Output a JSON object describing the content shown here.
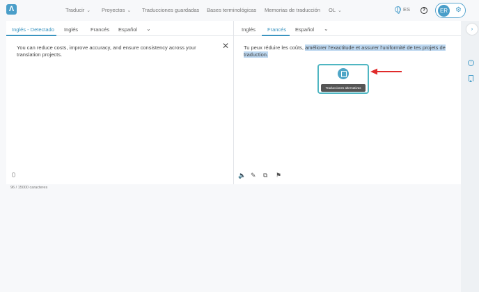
{
  "header": {
    "logo": "Λ",
    "nav": [
      {
        "label": "Traducir",
        "has_dropdown": true
      },
      {
        "label": "Proyectos",
        "has_dropdown": true
      },
      {
        "label": "Traducciones guardadas",
        "has_dropdown": false
      },
      {
        "label": "Bases terminológicas",
        "has_dropdown": false
      },
      {
        "label": "Memorias de traducción",
        "has_dropdown": false
      },
      {
        "label": "OL",
        "has_dropdown": true
      }
    ],
    "language": "ES",
    "help": "?",
    "user_initials": "ER"
  },
  "source": {
    "tabs": [
      "Inglés - Detectado",
      "Inglés",
      "Francés",
      "Español"
    ],
    "active_tab": 0,
    "text": "You can reduce costs, improve accuracy, and ensure consistency across your translation projects.",
    "char_count": "96 / 15000 caracteres"
  },
  "target": {
    "tabs": [
      "Inglés",
      "Francés",
      "Español"
    ],
    "active_tab": 1,
    "text_plain": "Tu peux réduire les coûts, ",
    "text_highlight": "améliorer l'exactitude et assurer l'uniformité de tes projets de traduction.",
    "alt_tooltip": "Traducciones alternativas"
  },
  "icons": {
    "chevron": "chevron-down-icon",
    "globe": "globe-icon",
    "help": "help-circle-icon",
    "settings": "gear-icon",
    "clear": "close-icon",
    "mic": "microphone-icon",
    "speaker": "speaker-icon",
    "edit": "pencil-icon",
    "copy": "copy-icon",
    "flag": "flag-icon",
    "alt": "alternatives-icon",
    "rail_expand": "chevron-right-icon",
    "rail_upload": "upload-icon",
    "rail_bookmark": "bookmark-icon"
  },
  "colors": {
    "accent": "#3a94c0",
    "highlight": "#bcd7f0",
    "annotation_box": "#4fb6c2",
    "annotation_arrow": "#e02b2b"
  }
}
